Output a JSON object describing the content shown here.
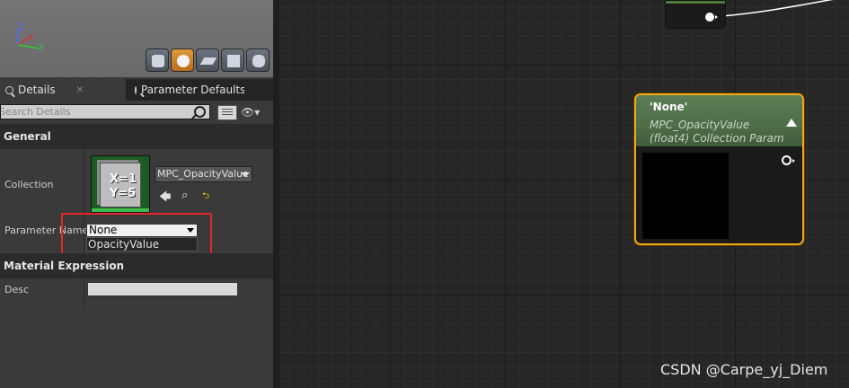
{
  "viewport": {
    "axes": {
      "z": "Z",
      "x": "X",
      "y": "Y"
    },
    "preview_buttons": [
      {
        "icon": "cylinder-icon"
      },
      {
        "icon": "sphere-icon",
        "active": true
      },
      {
        "icon": "plane-icon"
      },
      {
        "icon": "cube-icon"
      },
      {
        "icon": "custom-mesh-icon"
      }
    ]
  },
  "tabs": [
    {
      "label": "Details",
      "close": "✕"
    },
    {
      "label": "Parameter Defaults"
    }
  ],
  "search": {
    "placeholder": "Search Details"
  },
  "sections": {
    "general": "General",
    "material_expression": "Material Expression"
  },
  "properties": {
    "collection_label": "Collection",
    "collection_value": "MPC_OpacityValue",
    "thumbnail_lines": [
      "X=1",
      "Y=5"
    ],
    "parameter_name_label": "Parameter Name",
    "parameter_name_value": "None",
    "parameter_options": [
      "OpacityValue"
    ],
    "desc_label": "Desc",
    "desc_value": ""
  },
  "asset_actions": {
    "use": "🡄",
    "browse": "⌕",
    "clear": "⮌"
  },
  "node": {
    "title": "'None'",
    "subtitle_line1": "MPC_OpacityValue",
    "subtitle_line2": "(float4) Collection Param"
  },
  "watermark": "CSDN @Carpe_yj_Diem",
  "colors": {
    "highlight_box": "#e8262c",
    "node_selected_border": "#f0a81e",
    "node_header": "#4d6e47"
  }
}
